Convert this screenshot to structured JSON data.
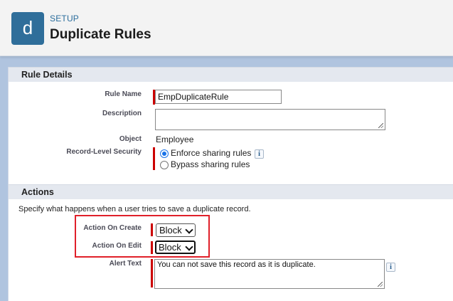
{
  "header": {
    "logo_letter": "d",
    "breadcrumb": "SETUP",
    "title": "Duplicate Rules"
  },
  "rule_details": {
    "section_title": "Rule Details",
    "rule_name_label": "Rule Name",
    "rule_name_value": "EmpDuplicateRule",
    "description_label": "Description",
    "description_value": "",
    "object_label": "Object",
    "object_value": "Employee",
    "security_label": "Record-Level Security",
    "security_options": [
      {
        "label": "Enforce sharing rules",
        "selected": true
      },
      {
        "label": "Bypass sharing rules",
        "selected": false
      }
    ],
    "info_icon": "i"
  },
  "actions": {
    "section_title": "Actions",
    "description": "Specify what happens when a user tries to save a duplicate record.",
    "on_create_label": "Action On Create",
    "on_create_value": "Block",
    "on_edit_label": "Action On Edit",
    "on_edit_value": "Block",
    "alert_text_label": "Alert Text",
    "alert_text_value": "You can not save this record as it is duplicate.",
    "info_icon": "i"
  },
  "colors": {
    "brand": "#2f6e9a",
    "required": "#cc0000",
    "highlight": "#e0202a",
    "radio_selected": "#1a73e8"
  }
}
